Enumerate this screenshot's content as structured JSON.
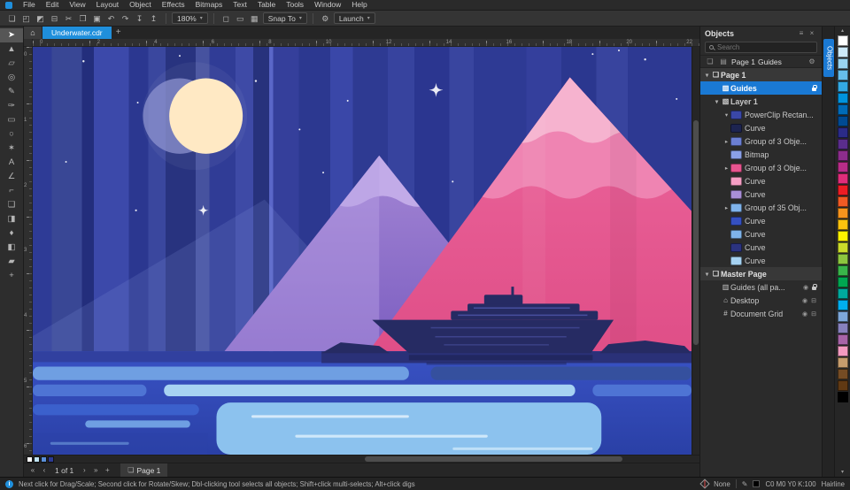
{
  "theme": {
    "accent": "#1f8fdc",
    "selection": "#1a79d4",
    "bg": "#1f1f1f",
    "menubar-bg": "#2a2a2a",
    "toolbar-bg": "#343434",
    "panel": "#2b2b2b",
    "statusbar-bg": "#232323",
    "ruler-bg": "#2f2f2f"
  },
  "icons": {
    "caret-down": "▾",
    "eye": "◉",
    "printer": "⊟",
    "pen": "✎"
  },
  "menu": {
    "items": [
      "File",
      "Edit",
      "View",
      "Layout",
      "Object",
      "Effects",
      "Bitmaps",
      "Text",
      "Table",
      "Tools",
      "Window",
      "Help"
    ]
  },
  "toolbar": {
    "left_icons": [
      {
        "name": "new-document-icon",
        "glyph": "❏"
      },
      {
        "name": "open-icon",
        "glyph": "◰"
      },
      {
        "name": "save-icon",
        "glyph": "◩"
      },
      {
        "name": "print-icon",
        "glyph": "⊟"
      },
      {
        "name": "cut-icon",
        "glyph": "✂"
      },
      {
        "name": "copy-icon",
        "glyph": "❐"
      },
      {
        "name": "paste-icon",
        "glyph": "▣"
      },
      {
        "name": "undo-icon",
        "glyph": "↶"
      },
      {
        "name": "redo-icon",
        "glyph": "↷"
      },
      {
        "name": "import-icon",
        "glyph": "↧"
      },
      {
        "name": "export-icon",
        "glyph": "↥"
      }
    ],
    "zoom_level": "180%",
    "view_icons": [
      {
        "name": "full-screen-preview-icon",
        "glyph": "◻"
      },
      {
        "name": "show-rulers-icon",
        "glyph": "▭"
      },
      {
        "name": "show-grid-icon",
        "glyph": "▦"
      }
    ],
    "snap_label": "Snap To",
    "options_icon": {
      "name": "options-icon",
      "glyph": "⚙"
    },
    "launch_label": "Launch"
  },
  "tabbar": {
    "home_icon": "⌂",
    "document_tab": "Underwater.cdr",
    "new_tab_label": "+"
  },
  "toolbox": {
    "tools": [
      {
        "name": "pick-tool",
        "glyph": "➤",
        "active": true
      },
      {
        "name": "shape-tool",
        "glyph": "▲"
      },
      {
        "name": "crop-tool",
        "glyph": "▱"
      },
      {
        "name": "zoom-tool",
        "glyph": "◎"
      },
      {
        "name": "freehand-tool",
        "glyph": "✎"
      },
      {
        "name": "artistic-media-tool",
        "glyph": "✑"
      },
      {
        "name": "rectangle-tool",
        "glyph": "▭"
      },
      {
        "name": "ellipse-tool",
        "glyph": "○"
      },
      {
        "name": "polygon-tool",
        "glyph": "✶"
      },
      {
        "name": "text-tool",
        "glyph": "A"
      },
      {
        "name": "parallel-dimension-tool",
        "glyph": "∠"
      },
      {
        "name": "connector-tool",
        "glyph": "⌐"
      },
      {
        "name": "drop-shadow-tool",
        "glyph": "❏"
      },
      {
        "name": "transparency-tool",
        "glyph": "◨"
      },
      {
        "name": "color-eyedropper-tool",
        "glyph": "♦"
      },
      {
        "name": "interactive-fill-tool",
        "glyph": "◧"
      },
      {
        "name": "smart-fill-tool",
        "glyph": "▰"
      },
      {
        "name": "add-tools-button",
        "glyph": "+"
      }
    ]
  },
  "rulers": {
    "h_labels": [
      "0",
      "2",
      "4",
      "6",
      "8",
      "10",
      "12",
      "14",
      "16",
      "18",
      "20",
      "22"
    ],
    "v_labels": [
      "0",
      "1",
      "2",
      "3",
      "4",
      "5",
      "6"
    ]
  },
  "objects_panel": {
    "title": "Objects",
    "header_icons": [
      {
        "name": "docker-options-icon",
        "glyph": "≡"
      },
      {
        "name": "close-docker-icon",
        "glyph": "×"
      }
    ],
    "search_placeholder": "Search",
    "subbar": {
      "icons": [
        {
          "name": "new-layer-icon",
          "glyph": "❏"
        },
        {
          "name": "view-options-icon",
          "glyph": "▤"
        }
      ],
      "breadcrumb_page": "Page 1",
      "breadcrumb_layer": "Guides",
      "settings_icon": "⚙"
    },
    "tree": [
      {
        "label": "Page 1",
        "indent": 0,
        "expander": "▾",
        "icon": "❏",
        "bold": true,
        "section": true
      },
      {
        "label": "Guides",
        "indent": 1,
        "icon": "▥",
        "bold": true,
        "selected": true,
        "lock": true
      },
      {
        "label": "Layer 1",
        "indent": 1,
        "expander": "▾",
        "icon": "▧",
        "bold": true
      },
      {
        "label": "PowerClip Rectan...",
        "indent": 2,
        "expander": "▾",
        "thumb": "#3a47a8"
      },
      {
        "label": "Curve",
        "indent": 2,
        "thumb": "#1d2450"
      },
      {
        "label": "Group of 3 Obje...",
        "indent": 2,
        "expander": "▸",
        "thumb": "#6b7fd4"
      },
      {
        "label": "Bitmap",
        "indent": 2,
        "thumb": "#8aa0e8"
      },
      {
        "label": "Group of 3 Obje...",
        "indent": 2,
        "expander": "▸",
        "thumb": "#e8548f"
      },
      {
        "label": "Curve",
        "indent": 2,
        "thumb": "#f59ec4"
      },
      {
        "label": "Curve",
        "indent": 2,
        "thumb": "#a98fd8"
      },
      {
        "label": "Group of 35 Obj...",
        "indent": 2,
        "expander": "▸",
        "thumb": "#7fb3ea"
      },
      {
        "label": "Curve",
        "indent": 2,
        "thumb": "#3550c0"
      },
      {
        "label": "Curve",
        "indent": 2,
        "thumb": "#7fb3ea"
      },
      {
        "label": "Curve",
        "indent": 2,
        "thumb": "#2b3380"
      },
      {
        "label": "Curve",
        "indent": 2,
        "thumb": "#a5d2f2"
      },
      {
        "label": "Master Page",
        "indent": 0,
        "expander": "▾",
        "icon": "❏",
        "bold": true,
        "section": true
      },
      {
        "label": "Guides (all pa...",
        "indent": 1,
        "icon": "▥",
        "eye": true,
        "lock": true
      },
      {
        "label": "Desktop",
        "indent": 1,
        "icon": "⌂",
        "eye": true,
        "print": true
      },
      {
        "label": "Document Grid",
        "indent": 1,
        "icon": "#",
        "eye": true,
        "print": true
      }
    ]
  },
  "docker_tabs": {
    "tabs": [
      {
        "label": "Objects",
        "active": true
      }
    ]
  },
  "palette": {
    "scroll_up": "▴",
    "scroll_down": "▾",
    "colors": [
      "#ffffff",
      "#cce9f8",
      "#99d4f1",
      "#66beeb",
      "#33a9e4",
      "#0093dd",
      "#006bb8",
      "#004a93",
      "#2b2b88",
      "#5a2d8c",
      "#8c2d8c",
      "#b82d88",
      "#e02d7a",
      "#ed1c24",
      "#f15a24",
      "#f7941d",
      "#ffc20e",
      "#fff200",
      "#cadb2a",
      "#8dc63f",
      "#39b54a",
      "#00a651",
      "#00a99d",
      "#00aeef",
      "#7da7d9",
      "#8781bd",
      "#a864a8",
      "#f49ac1",
      "#c69c6d",
      "#754c24",
      "#603913",
      "#000000"
    ]
  },
  "pagebar": {
    "nav_left": [
      {
        "name": "first-page-icon",
        "glyph": "«"
      },
      {
        "name": "prev-page-icon",
        "glyph": "‹"
      }
    ],
    "label": "1 of 1",
    "nav_right": [
      {
        "name": "next-page-icon",
        "glyph": "›"
      },
      {
        "name": "last-page-icon",
        "glyph": "»"
      },
      {
        "name": "add-page-icon",
        "glyph": "+"
      }
    ],
    "page_tab": "Page 1",
    "page_tab_icon": "❏"
  },
  "document_palette": {
    "colors": [
      "#ffffff",
      "#bfe3f5",
      "#5a8fd8",
      "#2c3a94"
    ]
  },
  "statusbar": {
    "hint": "Next click for Drag/Scale; Second click for Rotate/Skew; Dbl-clicking tool selects all objects; Shift+click multi-selects; Alt+click digs",
    "fill_label": "None",
    "outline_value": "C0 M0 Y0 K:100",
    "outline_width": "Hairline"
  },
  "artwork": {
    "sky": "#2e3a94",
    "stripe_dark": "#27327c",
    "stripe_light": "#46529f",
    "moon": "#ffe9c4",
    "moon_shadow": "#8d93cf",
    "mountain_pink": "#e75b97",
    "mountain_pink_light": "#f6b3cf",
    "mountain_purple": "#8a6bcc",
    "water": "#3952c4",
    "water_light": "#8cc2ee",
    "ship": "#262b63",
    "stars": "#ffffff"
  }
}
